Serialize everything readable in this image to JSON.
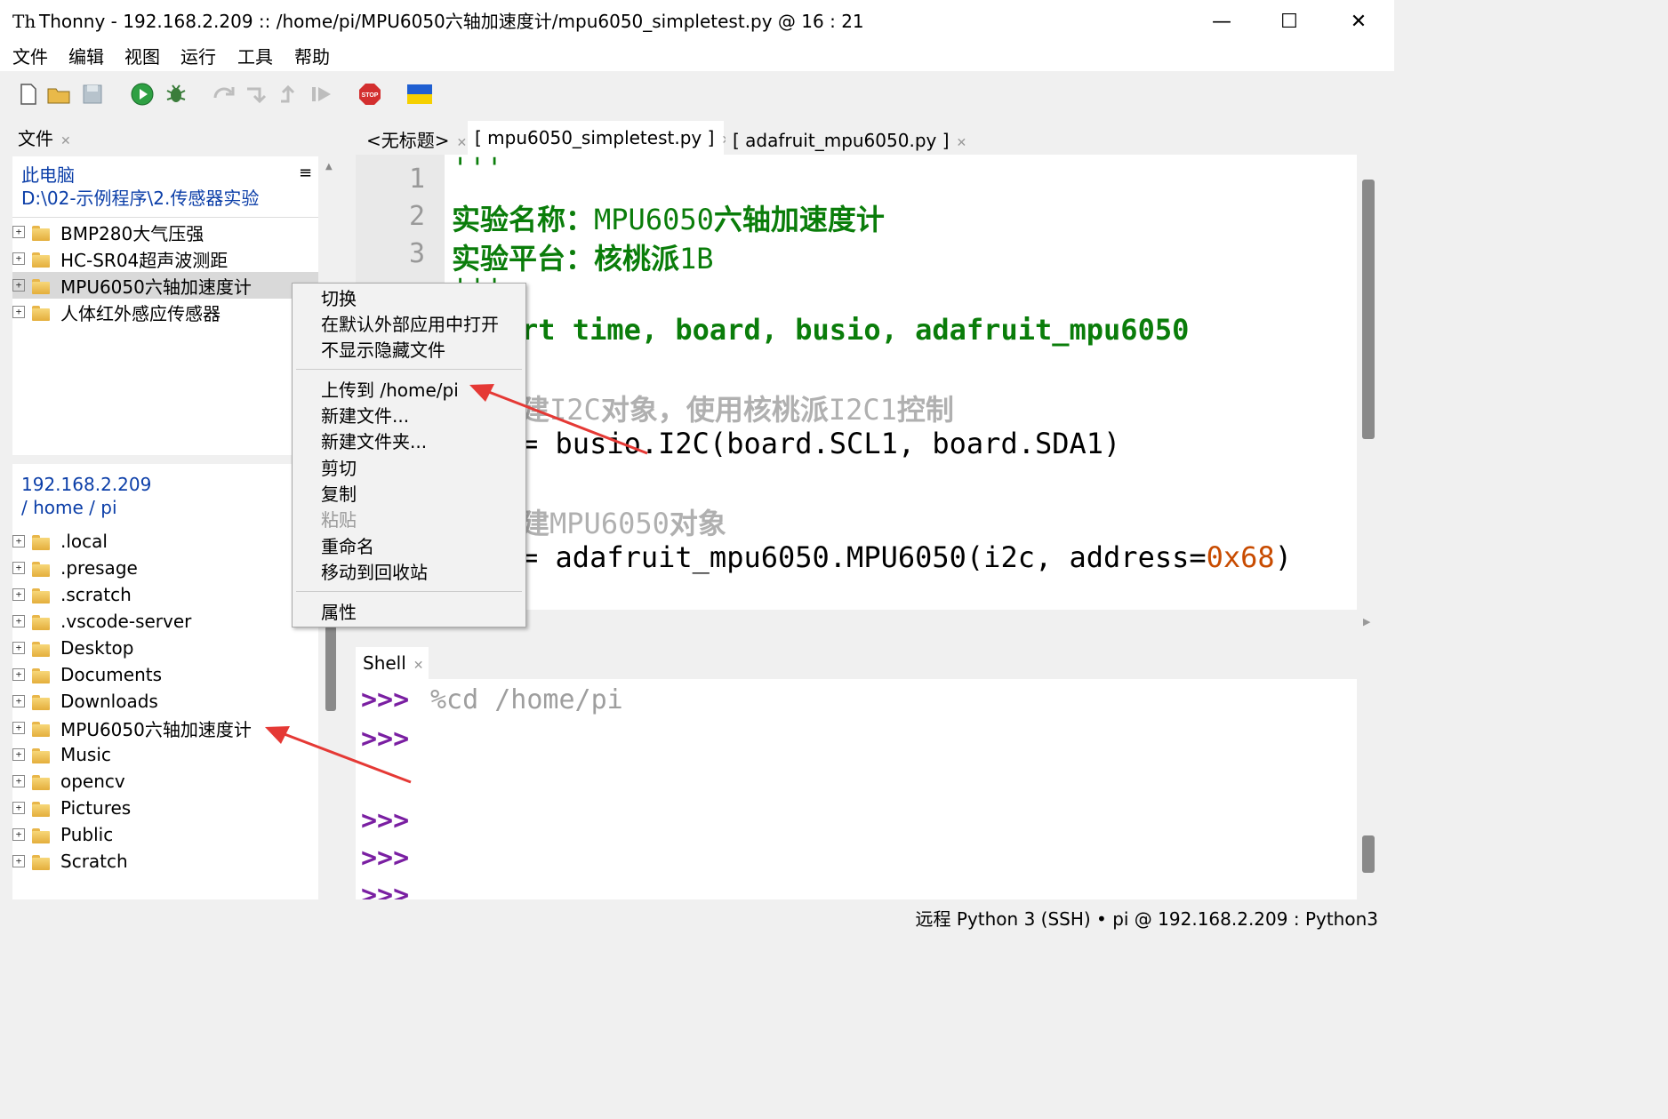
{
  "window": {
    "title": "Thonny  -  192.168.2.209 :: /home/pi/MPU6050六轴加速度计/mpu6050_simpletest.py  @  16 : 21",
    "minimize": "—",
    "maximize": "☐",
    "close": "✕"
  },
  "menu": [
    "文件",
    "编辑",
    "视图",
    "运行",
    "工具",
    "帮助"
  ],
  "files_tab": {
    "label": "文件"
  },
  "local_pane": {
    "title": "此电脑",
    "path": "D:\\02-示例程序\\2.传感器实验",
    "items": [
      "BMP280大气压强",
      "HC-SR04超声波测距",
      "MPU6050六轴加速度计",
      "人体红外感应传感器"
    ]
  },
  "remote_pane": {
    "host": "192.168.2.209",
    "path": "/ home / pi",
    "items": [
      ".local",
      ".presage",
      ".scratch",
      ".vscode-server",
      "Desktop",
      "Documents",
      "Downloads",
      "MPU6050六轴加速度计",
      "Music",
      "opencv",
      "Pictures",
      "Public",
      "Scratch"
    ]
  },
  "editor_tabs": [
    "<无标题>",
    "[ mpu6050_simpletest.py ]",
    "[ adafruit_mpu6050.py ]"
  ],
  "editor": {
    "line_numbers": [
      "1",
      "2",
      "3"
    ],
    "line1": "'''",
    "line2_label": "实验名称：",
    "line2_value_a": "MPU6050",
    "line2_value_b": "六轴加速度计",
    "line3_label": "实验平台：",
    "line3_value_a": "核桃派",
    "line3_value_b": "1B",
    "line4": "'''",
    "import_line": "rt time, board, busio, adafruit_mpu6050",
    "comment1_a": "建",
    "comment1_b": "I2C",
    "comment1_c": "对象，使用核桃派",
    "comment1_d": "I2C1",
    "comment1_e": "控制",
    "i2c_line": "= busio.I2C(board.SCL1, board.SDA1)",
    "comment2_a": "建",
    "comment2_b": "MPU6050",
    "comment2_c": "对象",
    "mpu_line": "= adafruit_mpu6050.MPU6050(i2c, address=",
    "mpu_addr": "0x68",
    "mpu_close": ")"
  },
  "context_menu": {
    "items": [
      "切换",
      "在默认外部应用中打开",
      "不显示隐藏文件",
      "上传到 /home/pi",
      "新建文件...",
      "新建文件夹...",
      "剪切",
      "复制",
      "粘贴",
      "重命名",
      "移动到回收站",
      "属性"
    ]
  },
  "shell": {
    "tab": "Shell",
    "prompt": ">>>",
    "command": "%cd /home/pi"
  },
  "status": "远程 Python 3 (SSH)  •  pi @ 192.168.2.209 : Python3",
  "colors": {
    "accent_arrow": "#e53935",
    "prompt": "#7a1fa2",
    "heading_green": "#0a7d0a"
  }
}
